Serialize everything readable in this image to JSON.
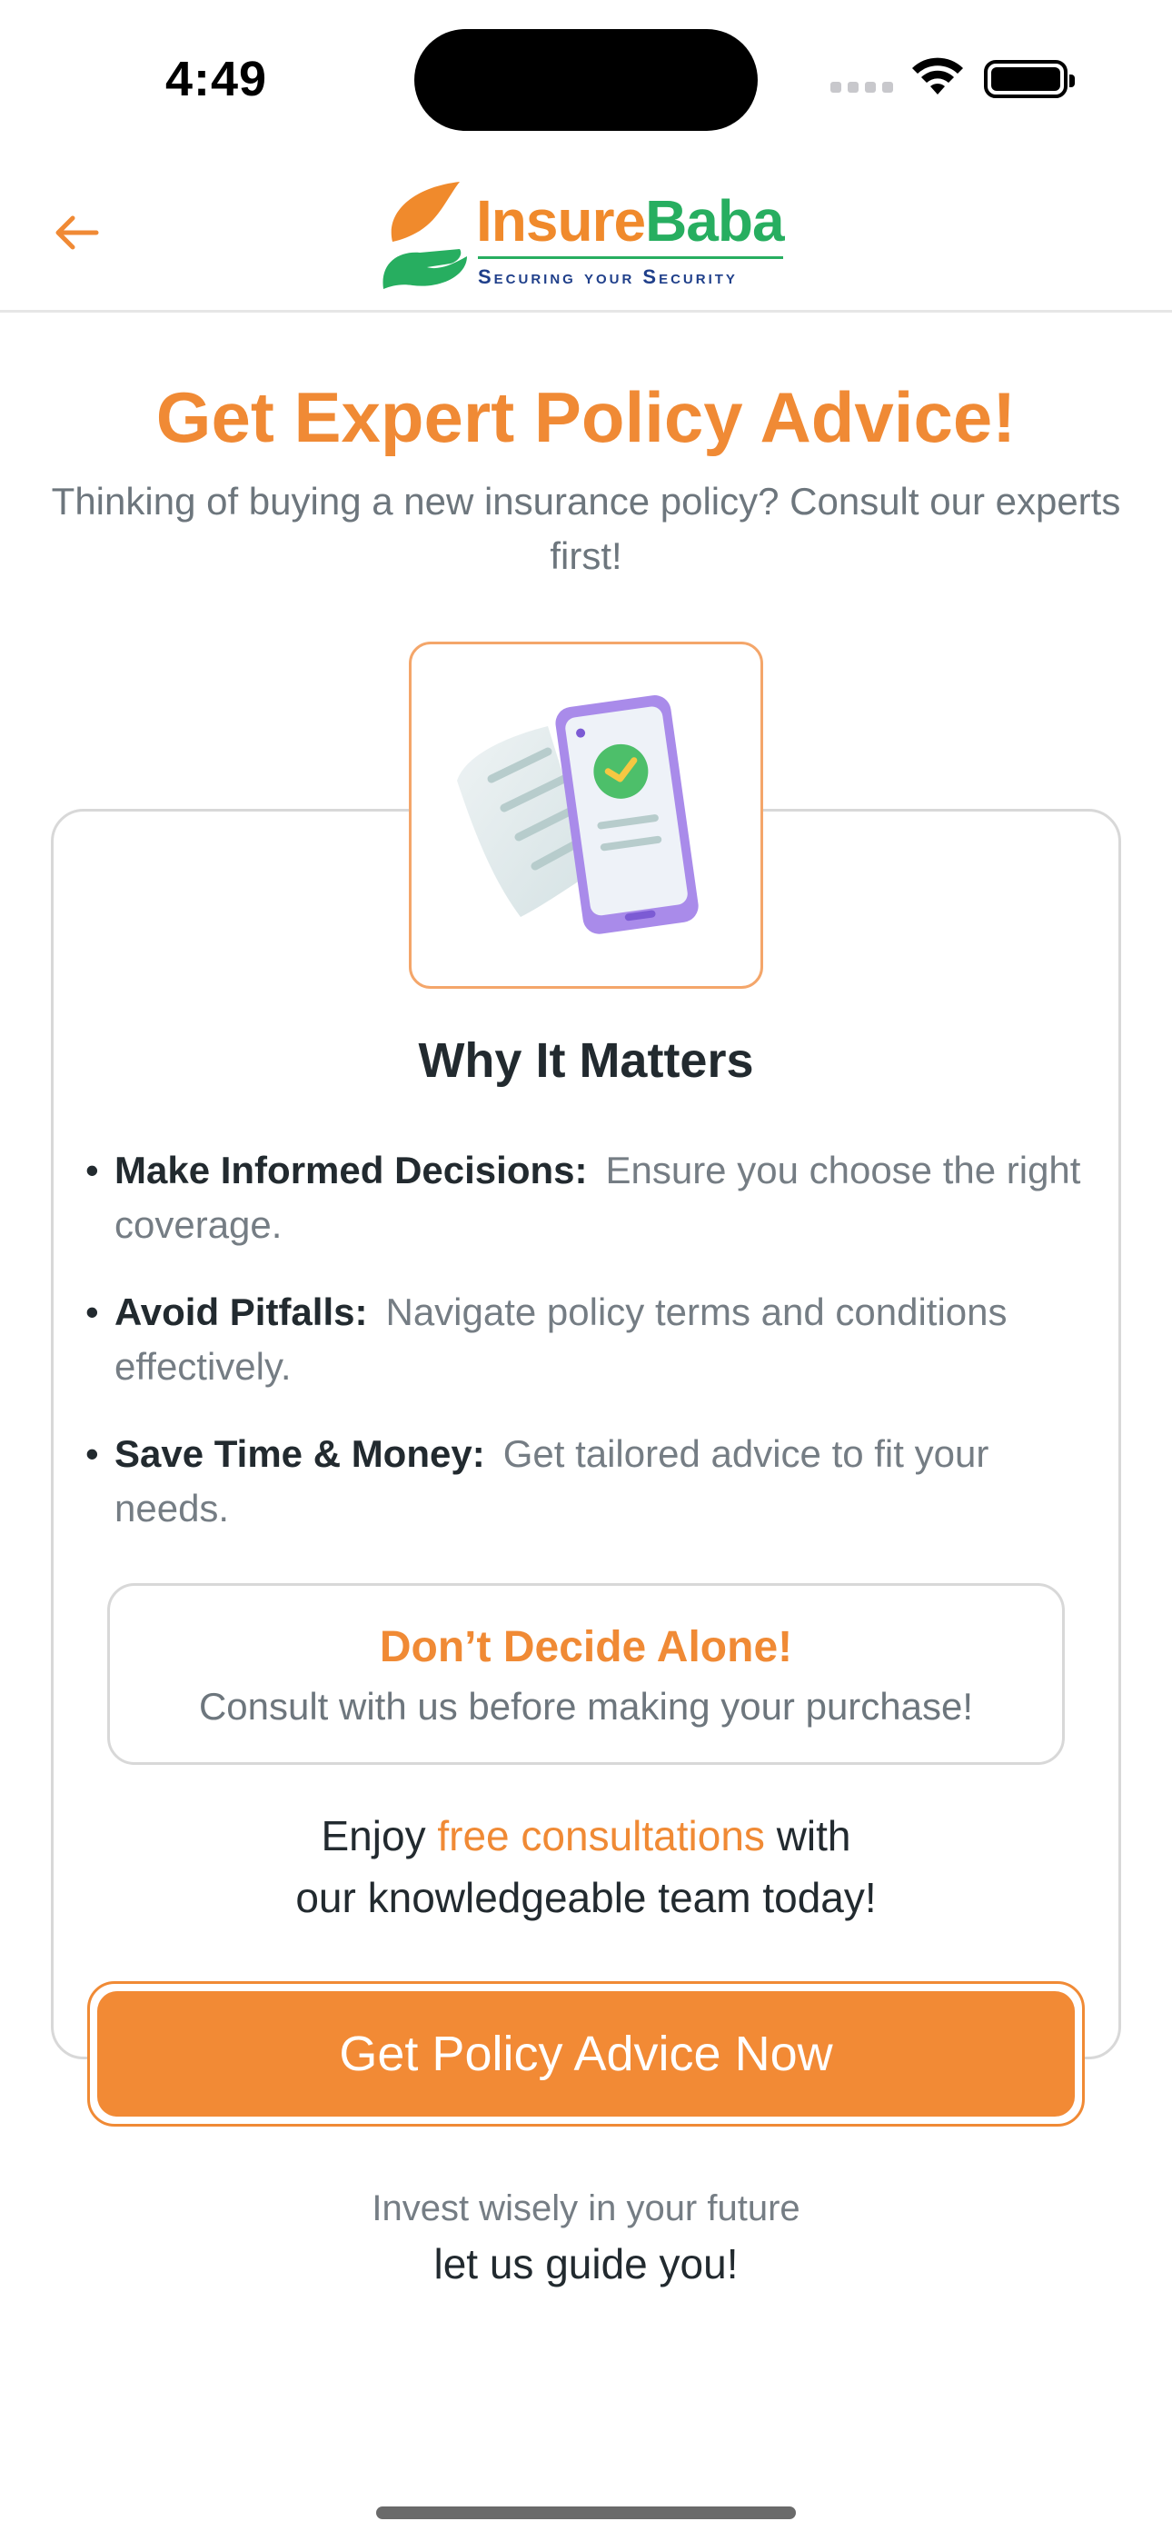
{
  "status_bar": {
    "time": "4:49"
  },
  "header": {
    "logo": {
      "brand_part1": "Insure",
      "brand_part2": "Baba",
      "tagline": "Securing your Security"
    }
  },
  "hero": {
    "title": "Get Expert Policy Advice!",
    "subtitle": "Thinking of buying a new insurance policy? Consult our experts first!"
  },
  "card": {
    "title": "Why It Matters",
    "bullets": [
      {
        "label": "Make Informed Decisions:",
        "text": "Ensure you choose the right coverage."
      },
      {
        "label": "Avoid Pitfalls:",
        "text": "Navigate policy terms and conditions effectively."
      },
      {
        "label": "Save Time & Money:",
        "text": "Get tailored advice to fit your needs."
      }
    ],
    "callout": {
      "title": "Don’t Decide Alone!",
      "text": "Consult with us before making your purchase!"
    },
    "enjoy": {
      "prefix": "Enjoy",
      "highlight": "free consultations",
      "suffix": "with",
      "line2": "our knowledgeable team today!"
    }
  },
  "cta": {
    "label": "Get Policy Advice Now"
  },
  "footer": {
    "line1": "Invest wisely in your future",
    "line2": "let us guide you!"
  },
  "colors": {
    "accent": "#f28a35",
    "brand_green": "#27ae60",
    "tagline_blue": "#1f3f8a"
  },
  "icons": {
    "back": "arrow-left-icon",
    "illustration": "policy-document-phone-icon"
  }
}
